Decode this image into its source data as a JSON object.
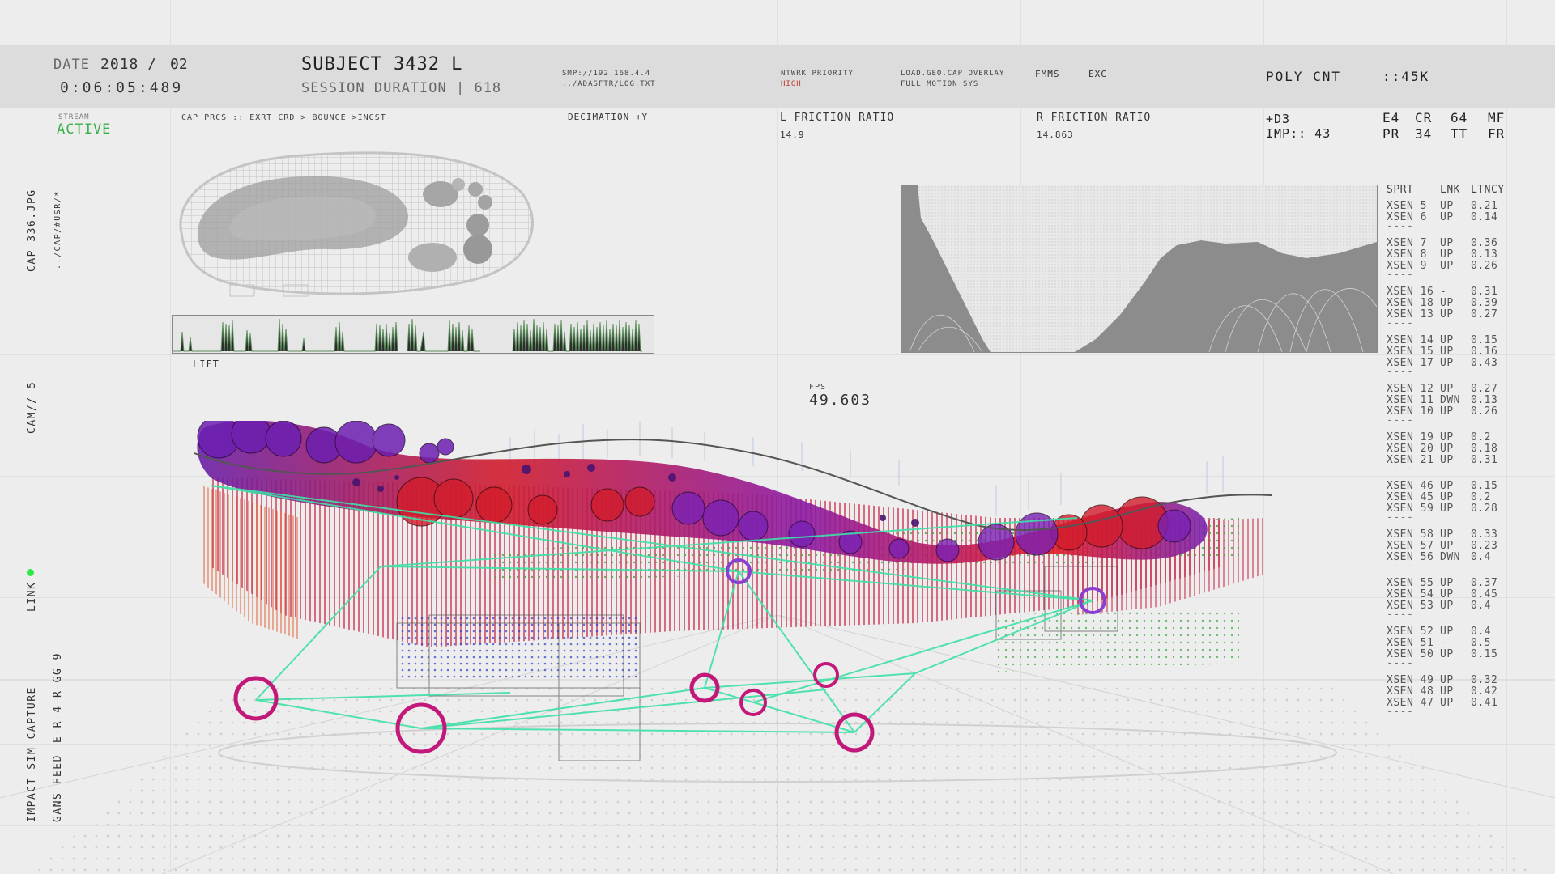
{
  "header": {
    "date_label": "DATE",
    "date_value": "2018",
    "date_slash": "/",
    "date_month": "02",
    "timecode": "0:06:05:489",
    "subject": "SUBJECT 3432 L",
    "session_duration": "SESSION DURATION | 618",
    "smp_path": "SMP://192.168.4.4",
    "log_path": "../ADASFTR/LOG.TXT",
    "ntwrk_label": "NTWRK PRIORITY",
    "ntwrk_value": "HIGH",
    "load_line1": "LOAD.GEO.CAP OVERLAY",
    "load_line2": "FULL MOTION SYS",
    "fmms": "FMMS",
    "exc": "EXC",
    "poly_cnt_label": "POLY CNT",
    "poly_cnt_value": "::45K"
  },
  "subheader": {
    "stream_label": "STREAM",
    "stream_status": "ACTIVE",
    "cap_prcs": "CAP PRCS :: EXRT CRD > BOUNCE >INGST",
    "decimation": "DECIMATION +Y",
    "l_friction_label": "L FRICTION RATIO",
    "l_friction_value": "14.9",
    "r_friction_label": "R FRICTION RATIO",
    "r_friction_value": "14.863",
    "d3": "+D3",
    "imp": "IMP:: 43",
    "codes_row1": [
      "E4",
      "CR",
      "64",
      "MF"
    ],
    "codes_row2": [
      "PR",
      "34",
      "TT",
      "FR"
    ]
  },
  "left_labels": {
    "cap_file": "CAP 336.JPG",
    "cap_path": "../CAP/#USR/*",
    "cam": "CAM// 5",
    "link": "LINK",
    "impact": "IMPACT SIM CAPTURE",
    "gans": "GANS FEED",
    "feed_code": "E-R-4-R-GG-9"
  },
  "viewport": {
    "lift_label": "LIFT",
    "fps_label": "FPS",
    "fps_value": "49.603"
  },
  "colors": {
    "accent_green": "#3bb14a",
    "link_dot": "#2ee84a",
    "alert_red": "#c0392b",
    "node_magenta": "#c2187a",
    "node_purple": "#8a3fd1",
    "wire_teal": "#3fe0a6"
  },
  "sensor_table": {
    "headers": [
      "SPRT",
      "LNK",
      "LTNCY"
    ],
    "groups": [
      [
        [
          "XSEN 5",
          "UP",
          "0.21"
        ],
        [
          "XSEN 6",
          "UP",
          "0.14"
        ]
      ],
      [
        [
          "XSEN 7",
          "UP",
          "0.36"
        ],
        [
          "XSEN 8",
          "UP",
          "0.13"
        ],
        [
          "XSEN 9",
          "UP",
          "0.26"
        ]
      ],
      [
        [
          "XSEN 16",
          "-",
          "0.31"
        ],
        [
          "XSEN 18",
          "UP",
          "0.39"
        ],
        [
          "XSEN 13",
          "UP",
          "0.27"
        ]
      ],
      [
        [
          "XSEN 14",
          "UP",
          "0.15"
        ],
        [
          "XSEN 15",
          "UP",
          "0.16"
        ],
        [
          "XSEN 17",
          "UP",
          "0.43"
        ]
      ],
      [
        [
          "XSEN 12",
          "UP",
          "0.27"
        ],
        [
          "XSEN 11",
          "DWN",
          "0.13"
        ],
        [
          "XSEN 10",
          "UP",
          "0.26"
        ]
      ],
      [
        [
          "XSEN 19",
          "UP",
          "0.2"
        ],
        [
          "XSEN 20",
          "UP",
          "0.18"
        ],
        [
          "XSEN 21",
          "UP",
          "0.31"
        ]
      ],
      [
        [
          "XSEN 46",
          "UP",
          "0.15"
        ],
        [
          "XSEN 45",
          "UP",
          "0.2"
        ],
        [
          "XSEN 59",
          "UP",
          "0.28"
        ]
      ],
      [
        [
          "XSEN 58",
          "UP",
          "0.33"
        ],
        [
          "XSEN 57",
          "UP",
          "0.23"
        ],
        [
          "XSEN 56",
          "DWN",
          "0.4"
        ]
      ],
      [
        [
          "XSEN 55",
          "UP",
          "0.37"
        ],
        [
          "XSEN 54",
          "UP",
          "0.45"
        ],
        [
          "XSEN 53",
          "UP",
          "0.4"
        ]
      ],
      [
        [
          "XSEN 52",
          "UP",
          "0.4"
        ],
        [
          "XSEN 51",
          "-",
          "0.5"
        ],
        [
          "XSEN 50",
          "UP",
          "0.15"
        ]
      ],
      [
        [
          "XSEN 49",
          "UP",
          "0.32"
        ],
        [
          "XSEN 48",
          "UP",
          "0.42"
        ],
        [
          "XSEN 47",
          "UP",
          "0.41"
        ]
      ]
    ]
  }
}
